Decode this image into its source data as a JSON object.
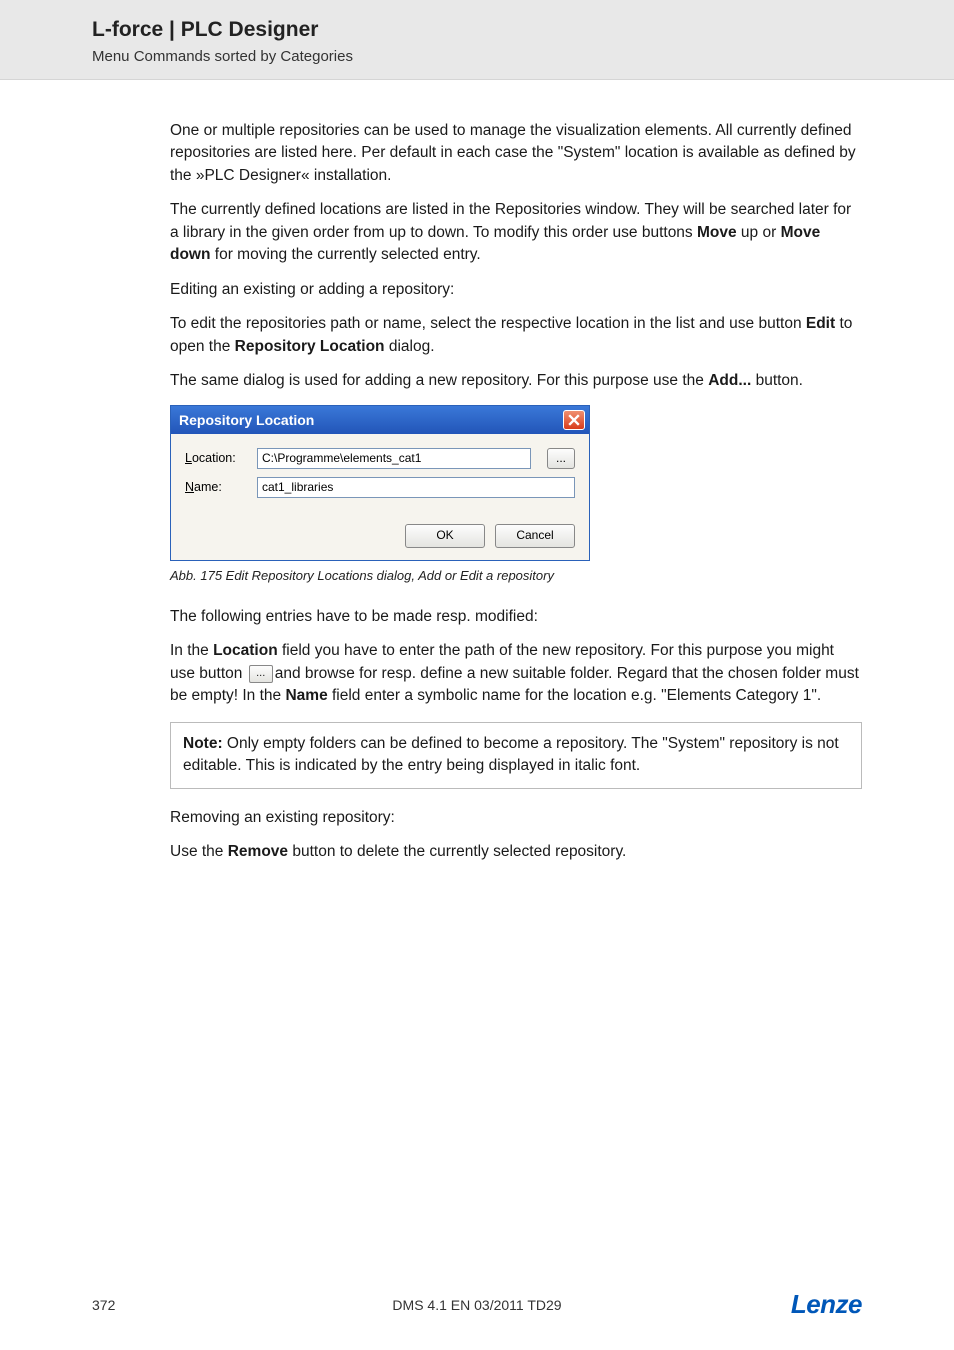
{
  "header": {
    "title": "L-force | PLC Designer",
    "subtitle": "Menu Commands sorted by Categories"
  },
  "body": {
    "p1": "One or multiple repositories can be used to manage the visualization elements. All currently defined repositories are listed here. Per default in each case the \"System\" location is available as defined by the »PLC Designer« installation.",
    "p2a": "The currently defined locations are listed in the Repositories window. They will be searched later for a library in the given order from up to down. To modify this order use buttons ",
    "p2_move": "Move",
    "p2b": " up or ",
    "p2_movedown": "Move down",
    "p2c": " for moving the currently selected entry.",
    "p3": "Editing an existing or adding a repository:",
    "p4a": "To edit the repositories path or name, select the respective location in the list and use button ",
    "p4_edit": "Edit",
    "p4b": " to open the ",
    "p4_reploc": "Repository Location",
    "p4c": " dialog.",
    "p5a": "The same dialog is used for adding a new repository. For this purpose use the ",
    "p5_add": "Add...",
    "p5b": " button.",
    "caption": "Abb. 175     Edit Repository Locations dialog, Add or Edit a repository",
    "p6": "The following entries have to be made resp. modified:",
    "p7a": "In the ",
    "p7_loc": "Location",
    "p7b": " field you have to enter the path of the new repository. For this purpose you might use button ",
    "p7c": "and browse for resp. define a new suitable folder. Regard that the chosen folder must be empty! In the ",
    "p7_name": "Name",
    "p7d": " field enter a symbolic name for the location e.g. \"Elements Category 1\".",
    "note_label": "Note:",
    "note_text": " Only empty folders can be defined to become a repository. The \"System\" repository is not editable. This is indicated by the entry being displayed in italic font.",
    "p8": "Removing an existing repository:",
    "p9a": "Use the ",
    "p9_remove": "Remove",
    "p9b": " button to delete the currently selected repository."
  },
  "dialog": {
    "title": "Repository Location",
    "location_label_ul": "L",
    "location_label_rest": "ocation:",
    "location_value": "C:\\Programme\\elements_cat1",
    "name_label_ul": "N",
    "name_label_rest": "ame:",
    "name_value": "cat1_libraries",
    "browse_glyph": "...",
    "ok": "OK",
    "cancel": "Cancel"
  },
  "inline_browse_glyph": "...",
  "footer": {
    "page": "372",
    "docref": "DMS 4.1 EN 03/2011 TD29",
    "logo": "Lenze"
  }
}
